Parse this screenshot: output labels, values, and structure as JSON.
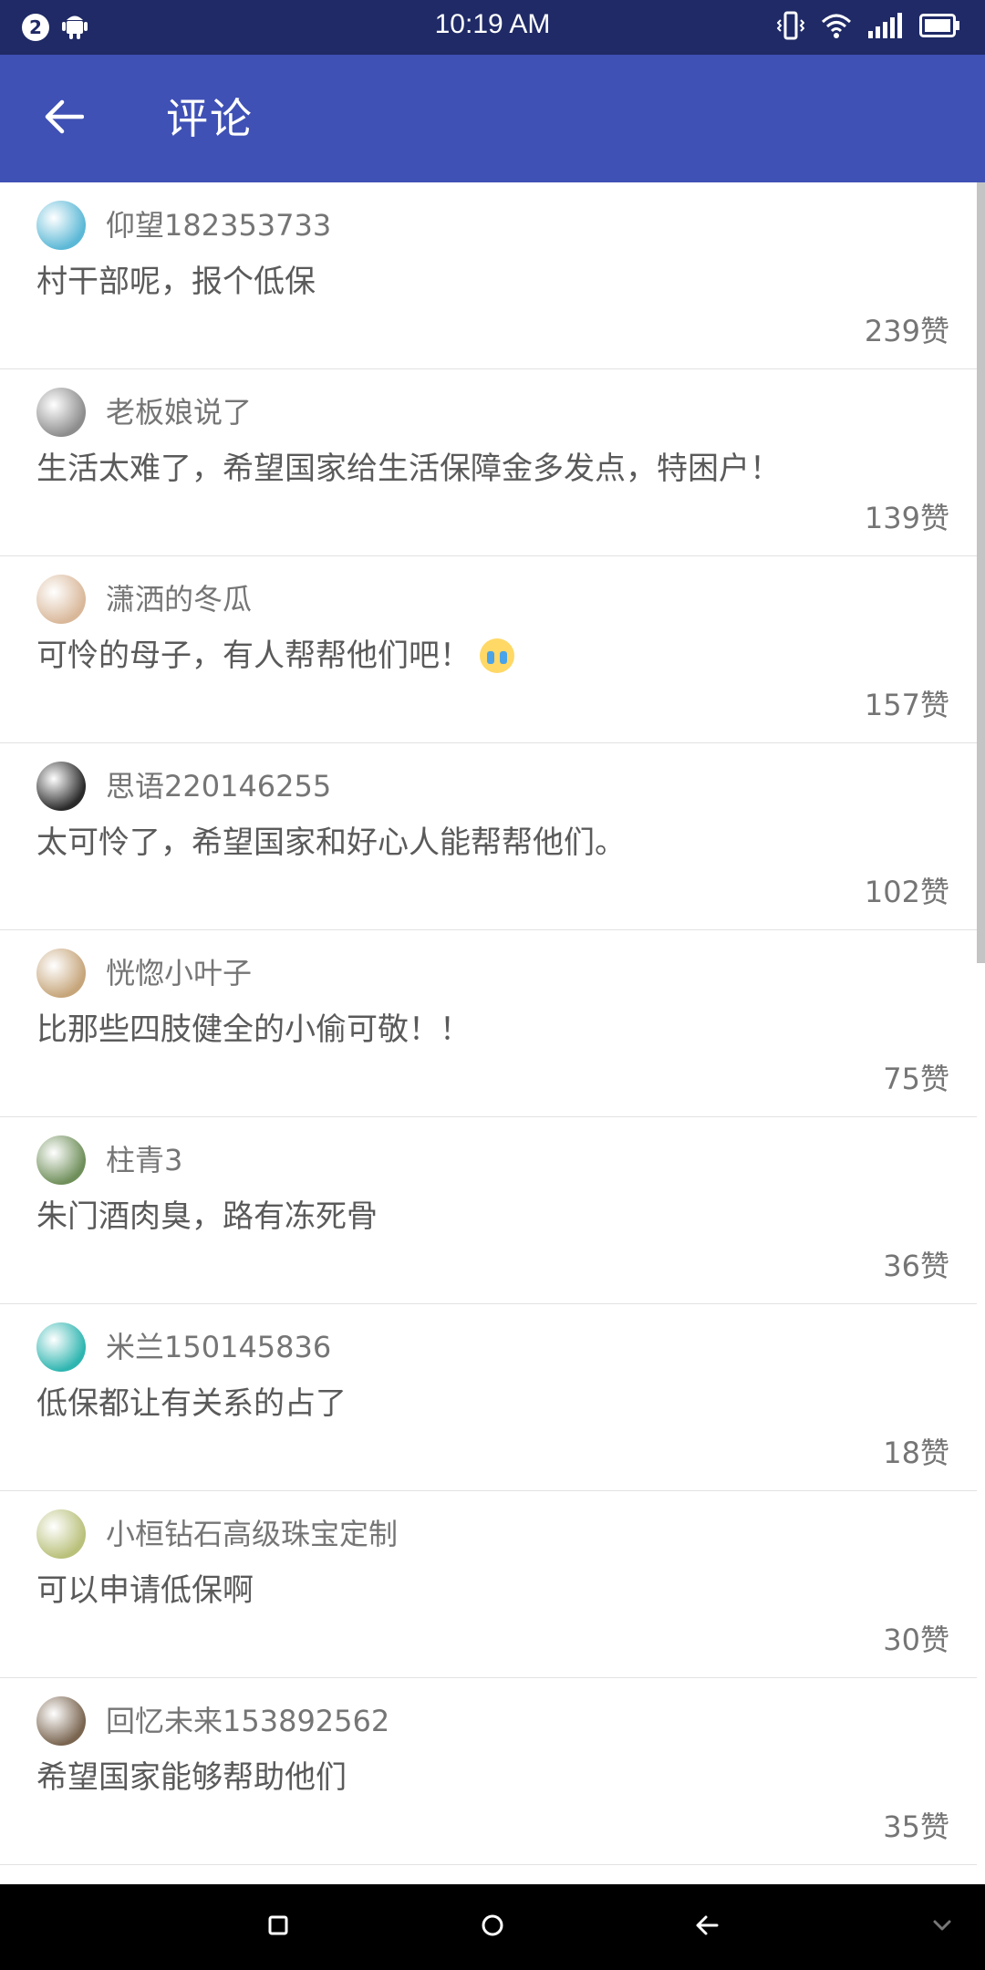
{
  "status_bar": {
    "notification_count": "2",
    "time": "10:19 AM",
    "icons": [
      "android-icon",
      "vibrate-icon",
      "wifi-icon",
      "signal-icon",
      "battery-icon"
    ]
  },
  "app_bar": {
    "title": "评论",
    "back_icon": "arrow-left-icon",
    "color": "#3f51b5"
  },
  "comments": [
    {
      "username": "仰望182353733",
      "text": "村干部呢，报个低保",
      "likes": "239赞",
      "avatar_color": "#5bb8d6"
    },
    {
      "username": "老板娘说了",
      "text": "生活太难了，希望国家给生活保障金多发点，特困户！",
      "likes": "139赞",
      "avatar_color": "#8d8d8d"
    },
    {
      "username": "潇洒的冬瓜",
      "text": "可怜的母子，有人帮帮他们吧！",
      "likes": "157赞",
      "avatar_color": "#d9b89a",
      "emoji": "crying-face-icon"
    },
    {
      "username": "思语220146255",
      "text": "太可怜了，希望国家和好心人能帮帮他们。",
      "likes": "102赞",
      "avatar_color": "#2a2a2a"
    },
    {
      "username": "恍惚小叶子",
      "text": "比那些四肢健全的小偷可敬！！",
      "likes": "75赞",
      "avatar_color": "#c6a57a"
    },
    {
      "username": "柱青3",
      "text": "朱门酒肉臭，路有冻死骨",
      "likes": "36赞",
      "avatar_color": "#6f8f5a"
    },
    {
      "username": "米兰150145836",
      "text": "低保都让有关系的占了",
      "likes": "18赞",
      "avatar_color": "#2fb5b0"
    },
    {
      "username": "小桓钻石高级珠宝定制",
      "text": "可以申请低保啊",
      "likes": "30赞",
      "avatar_color": "#b9c07a"
    },
    {
      "username": "回忆未来153892562",
      "text": "希望国家能够帮助他们",
      "likes": "35赞",
      "avatar_color": "#7a6550"
    }
  ],
  "nav_bar": {
    "icons": [
      "recent-apps-icon",
      "home-icon",
      "back-icon",
      "chevron-down-icon"
    ]
  }
}
